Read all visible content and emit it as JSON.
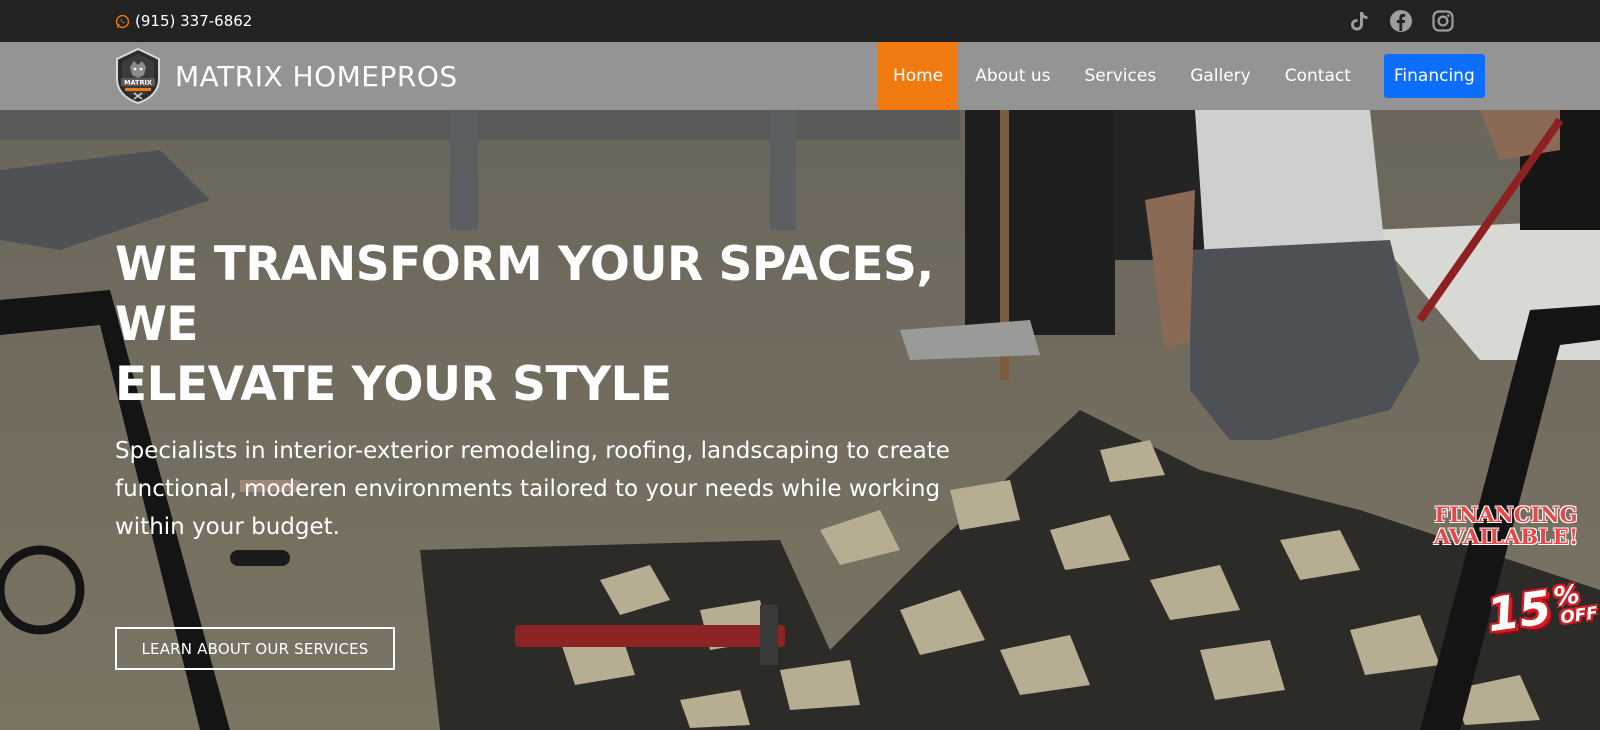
{
  "topbar": {
    "phone": "(915) 337-6862",
    "phone_icon": "whatsapp-icon",
    "socials": [
      "tiktok-icon",
      "facebook-icon",
      "instagram-icon"
    ]
  },
  "nav": {
    "brand": "MATRIX HOMEPROS",
    "logo_text": "MATRIX",
    "items": [
      {
        "label": "Home",
        "active": true
      },
      {
        "label": "About us"
      },
      {
        "label": "Services"
      },
      {
        "label": "Gallery"
      },
      {
        "label": "Contact"
      }
    ],
    "cta": "Financing"
  },
  "hero": {
    "title_line1": "WE TRANSFORM YOUR SPACES, WE",
    "title_line2": "ELEVATE YOUR STYLE",
    "subtitle": "Specialists in interior-exterior remodeling, roofing, landscaping to create functional, moderen environments tailored to your needs while working within your budget.",
    "button": "LEARN ABOUT OUR SERVICES",
    "badge_financing_line1": "FINANCING",
    "badge_financing_line2": "AVAILABLE!",
    "badge_off_number": "15",
    "badge_off_percent": "%",
    "badge_off_text": "OFF"
  },
  "colors": {
    "topbar": "#222222",
    "navbar": "#949494",
    "active_nav": "#f07a10",
    "financing_button": "#0d6efd",
    "badge_red": "#e8474a"
  }
}
